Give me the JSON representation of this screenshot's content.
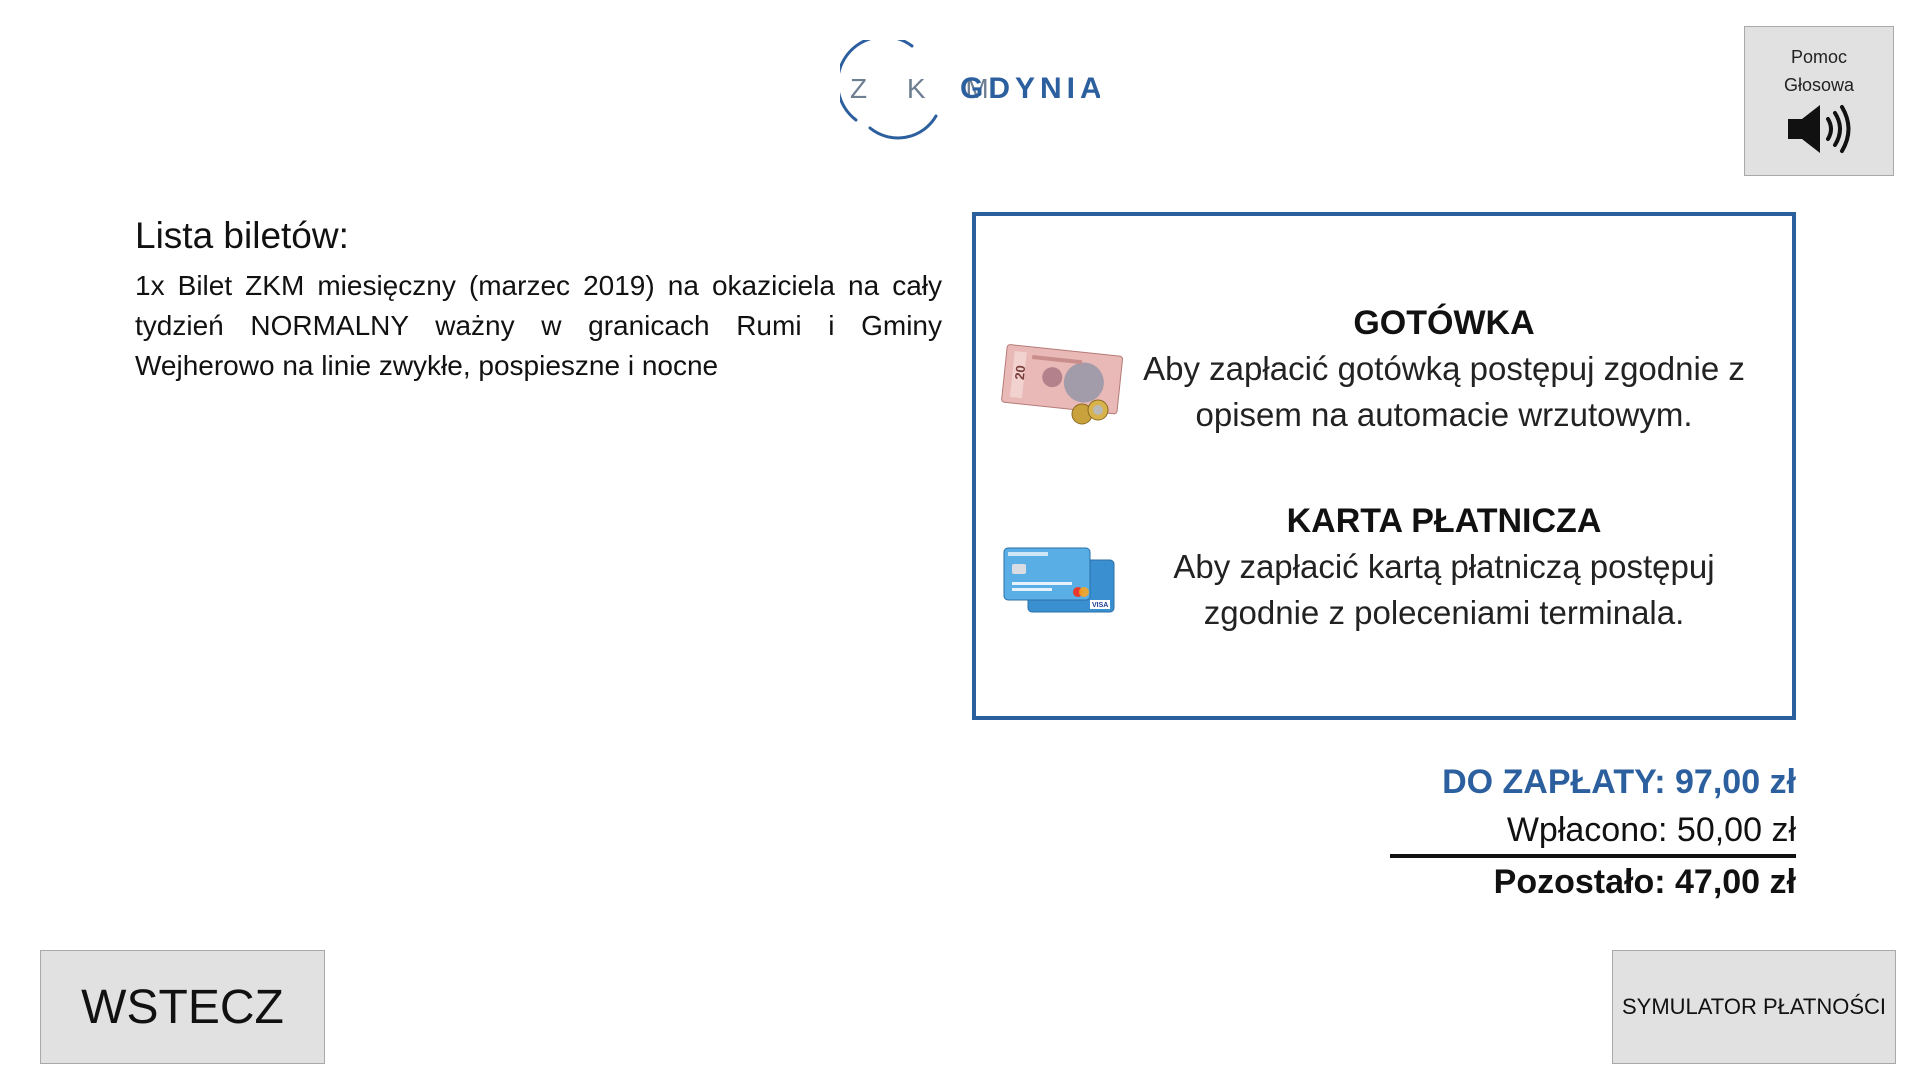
{
  "logo": {
    "left_text": "Z K M",
    "right_text": "GDYNIA",
    "brand_color": "#2c5f9e"
  },
  "voice_help": {
    "label": "Pomoc\nGłosowa",
    "icon": "speaker-icon"
  },
  "tickets": {
    "heading": "Lista biletów:",
    "items": [
      "1x Bilet ZKM miesięczny (marzec 2019) na okaziciela na cały tydzień NORMALNY ważny w granicach Rumi i Gminy Wejherowo na linie zwykłe, pospieszne i nocne"
    ]
  },
  "payment_methods": {
    "border_color": "#2c5f9e",
    "cash": {
      "title": "GOTÓWKA",
      "description": "Aby zapłacić gotówką postępuj zgodnie z opisem na automacie wrzutowym.",
      "icon": "banknote-coins-icon"
    },
    "card": {
      "title": "KARTA PŁATNICZA",
      "description": "Aby zapłacić kartą płatniczą postępuj zgodnie z poleceniami terminala.",
      "icon": "payment-cards-icon"
    }
  },
  "totals": {
    "due": "DO ZAPŁATY: 97,00 zł",
    "paid": "Wpłacono: 50,00 zł",
    "remaining": "Pozostało: 47,00 zł"
  },
  "buttons": {
    "back": "WSTECZ",
    "simulator": "SYMULATOR PŁATNOŚCI"
  }
}
